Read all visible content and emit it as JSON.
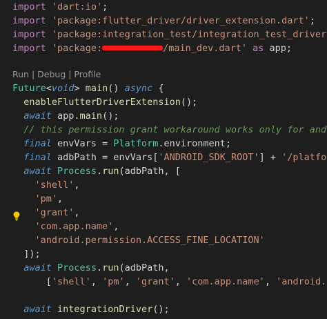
{
  "codelens": {
    "run": "Run",
    "sep1": " | ",
    "debug": "Debug",
    "sep2": " | ",
    "profile": "Profile"
  },
  "code": {
    "l1": {
      "a": "import",
      "b": " ",
      "c": "'dart:io'",
      "d": ";"
    },
    "l2": {
      "a": "import",
      "b": " ",
      "c": "'package:flutter_driver/driver_extension.dart'",
      "d": ";"
    },
    "l3": {
      "a": "import",
      "b": " ",
      "c": "'package:integration_test/integration_test_driver"
    },
    "l4": {
      "a": "import",
      "b": " ",
      "c": "'package:",
      "d": "/main_dev.dart'",
      "e": " ",
      "f": "as",
      "g": " app;"
    },
    "l6": {
      "a": "Future",
      "b": "<",
      "c": "void",
      "d": "> ",
      "e": "main",
      "f": "() ",
      "g": "async",
      "h": " {"
    },
    "l7": {
      "a": "  ",
      "b": "enableFlutterDriverExtension",
      "c": "();"
    },
    "l8": {
      "a": "  ",
      "b": "await",
      "c": " app.",
      "d": "main",
      "e": "();"
    },
    "l9": {
      "a": "  // this permission grant workaround works only for and"
    },
    "l10": {
      "a": "  ",
      "b": "final",
      "c": " envVars = ",
      "d": "Platform",
      "e": ".environment;"
    },
    "l11": {
      "a": "  ",
      "b": "final",
      "c": " adbPath = envVars[",
      "d": "'ANDROID_SDK_ROOT'",
      "e": "] + ",
      "f": "'/platfo"
    },
    "l12": {
      "a": "  ",
      "b": "await",
      "c": " ",
      "d": "Process",
      "e": ".",
      "f": "run",
      "g": "(adbPath, ["
    },
    "l13": {
      "a": "    ",
      "b": "'shell'",
      "c": ","
    },
    "l14": {
      "a": "    ",
      "b": "'pm'",
      "c": ","
    },
    "l15": {
      "a": "    ",
      "b": "'grant'",
      "c": ","
    },
    "l16": {
      "a": "    ",
      "b": "'com.app.name'",
      "c": ","
    },
    "l17": {
      "a": "    ",
      "b": "'android.permission.ACCESS_FINE_LOCATION'"
    },
    "l18": {
      "a": "  ]);"
    },
    "l19": {
      "a": "  ",
      "b": "await",
      "c": " ",
      "d": "Process",
      "e": ".",
      "f": "run",
      "g": "(adbPath,"
    },
    "l20": {
      "a": "      [",
      "b": "'shell'",
      "c": ", ",
      "d": "'pm'",
      "e": ", ",
      "f": "'grant'",
      "g": ", ",
      "h": "'com.app.name'",
      "i": ", ",
      "j": "'android."
    },
    "l22": {
      "a": "  ",
      "b": "await",
      "c": " ",
      "d": "integrationDriver",
      "e": "();"
    }
  },
  "colors": {
    "background": "#1e1e1e",
    "keyword": "#c586c0",
    "string": "#ce9178",
    "type": "#4ec9b0",
    "function": "#dcdcaa",
    "comment": "#6a9955",
    "redaction": "#ff1a1a",
    "lightbulb": "#ffcc00"
  },
  "icons": {
    "lightbulb": "lightbulb-icon"
  }
}
